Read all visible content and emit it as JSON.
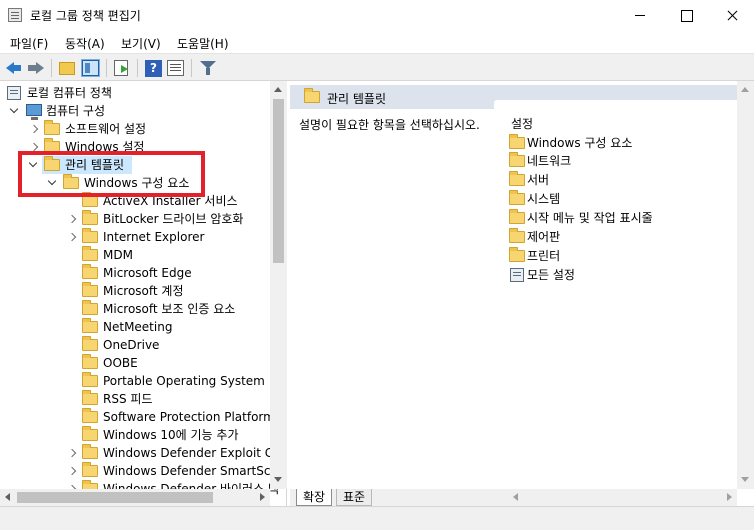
{
  "window": {
    "title": "로컬 그룹 정책 편집기"
  },
  "menu": [
    {
      "label": "파일(F)"
    },
    {
      "label": "동작(A)"
    },
    {
      "label": "보기(V)"
    },
    {
      "label": "도움말(H)"
    }
  ],
  "toolbar": {
    "help_label": "?"
  },
  "tree": {
    "root": "로컬 컴퓨터 정책",
    "computer_config": "컴퓨터 구성",
    "software_settings": "소프트웨어 설정",
    "windows_settings": "Windows 설정",
    "admin_templates": "관리 템플릿",
    "windows_components": "Windows 구성 요소",
    "children": [
      "ActiveX Installer 서비스",
      "BitLocker 드라이브 암호화",
      "Internet Explorer",
      "MDM",
      "Microsoft Edge",
      "Microsoft 계정",
      "Microsoft 보조 인증 요소",
      "NetMeeting",
      "OneDrive",
      "OOBE",
      "Portable Operating System",
      "RSS 피드",
      "Software Protection Platform",
      "Windows 10에 기능 추가",
      "Windows Defender Exploit Gua",
      "Windows Defender SmartScree",
      "Windows Defender 바이러스 백"
    ]
  },
  "right": {
    "header_title": "관리 템플릿",
    "description": "설명이 필요한 항목을 선택하십시오.",
    "column_header": "설정",
    "items": [
      "Windows 구성 요소",
      "네트워크",
      "서버",
      "시스템",
      "시작 메뉴 및 작업 표시줄",
      "제어판",
      "프린터",
      "모든 설정"
    ]
  },
  "tabs": {
    "extended": "확장",
    "standard": "표준"
  },
  "colors": {
    "highlight_box": "#e3212a",
    "selection": "#cce8ff",
    "header_bg": "#dde3ec"
  }
}
